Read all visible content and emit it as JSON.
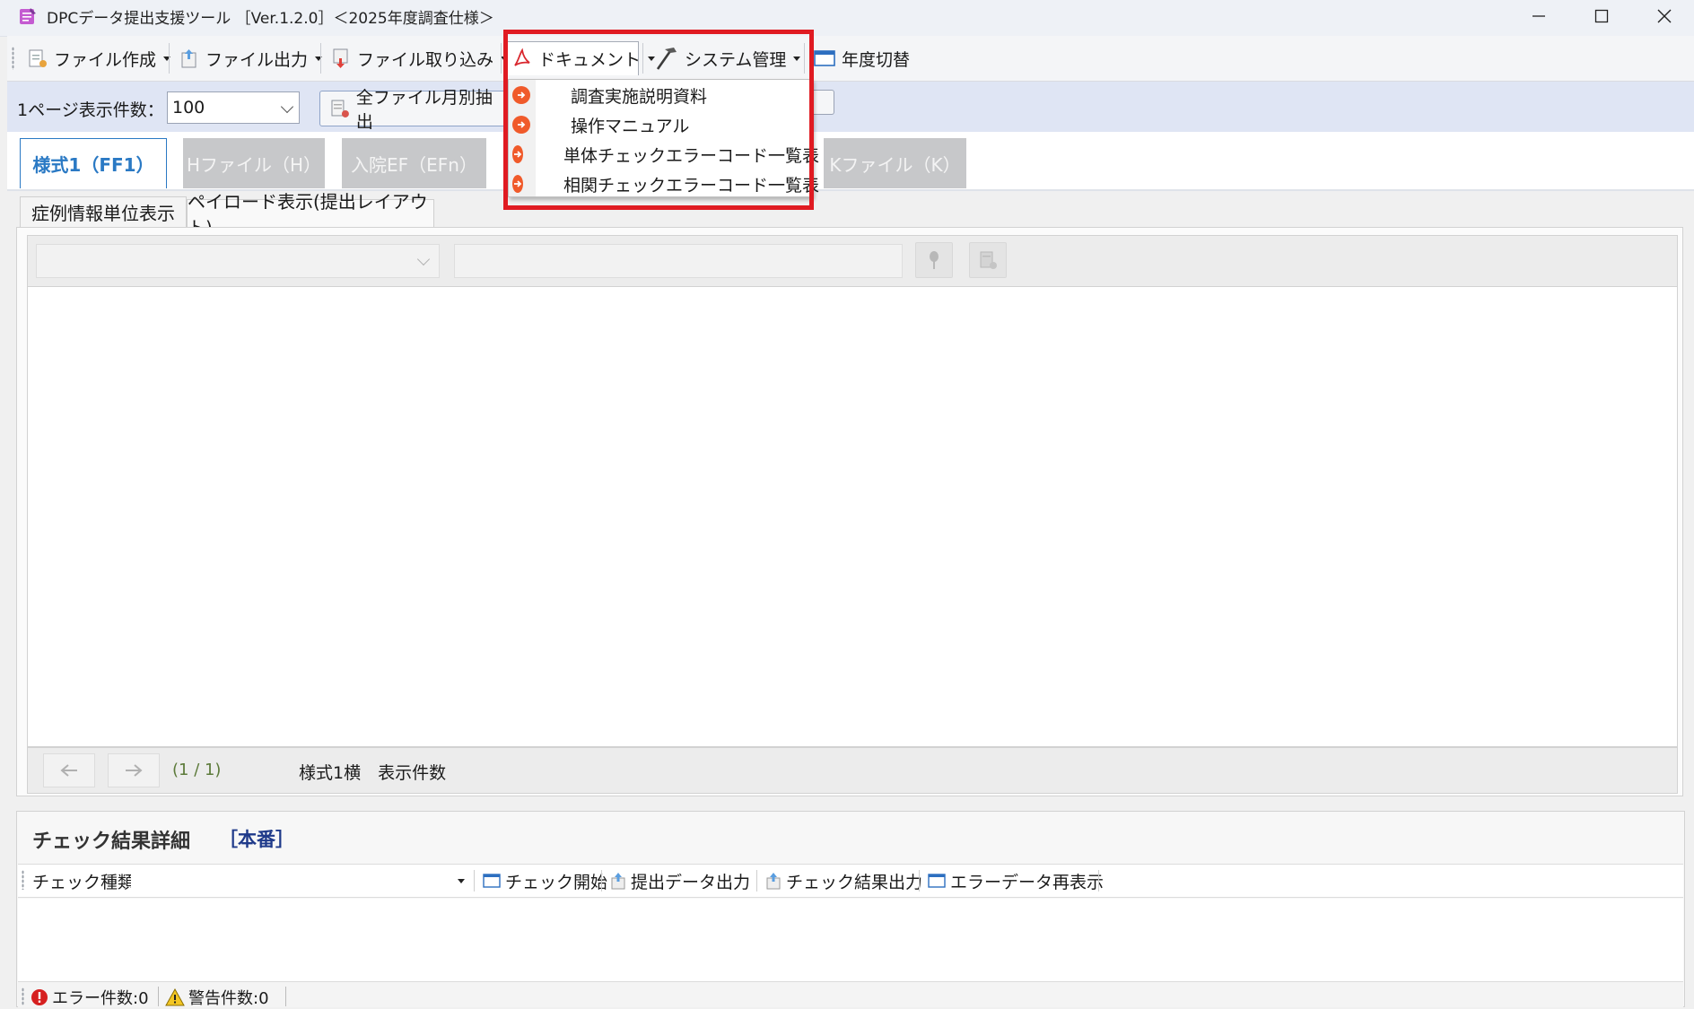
{
  "window": {
    "title": "DPCデータ提出支援ツール ［Ver.1.2.0］＜2025年度調査仕様＞"
  },
  "menubar": {
    "file_create": "ファイル作成",
    "file_output": "ファイル出力",
    "file_import": "ファイル取り込み",
    "document": "ドキュメント",
    "system_admin": "システム管理",
    "year_switch": "年度切替"
  },
  "document_menu": {
    "items": [
      {
        "label": "調査実施説明資料"
      },
      {
        "label": "操作マニュアル"
      },
      {
        "label": "単体チェックエラーコード一覧表"
      },
      {
        "label": "相関チェックエラーコード一覧表"
      }
    ]
  },
  "filter": {
    "page_size_label": "1ページ表示件数：",
    "page_size_value": "100",
    "extract_button": "全ファイル月別抽出"
  },
  "file_tabs": [
    {
      "label": "様式1（FF1）"
    },
    {
      "label": "Hファイル（H）"
    },
    {
      "label": "入院EF（EFn）"
    },
    {
      "label": "Kファイル（K）"
    }
  ],
  "sub_tabs": [
    {
      "label": "症例情報単位表示"
    },
    {
      "label": "ペイロード表示(提出レイアウト)"
    }
  ],
  "pager": {
    "page_indicator": "(1 / 1)",
    "count_label": "様式1横　表示件数"
  },
  "check_panel": {
    "title": "チェック結果詳細",
    "mode": "［本番］",
    "check_type_label": "チェック種類:",
    "start_check": "チェック開始",
    "submit_output": "提出データ出力",
    "result_output": "チェック結果出力",
    "error_redisplay": "エラーデータ再表示"
  },
  "status": {
    "errors": "エラー件数:0",
    "warnings": "警告件数:0"
  },
  "colors": {
    "accent": "#2a79c4",
    "highlight": "#e01b22",
    "doc_bullet": "#f05a2a"
  }
}
